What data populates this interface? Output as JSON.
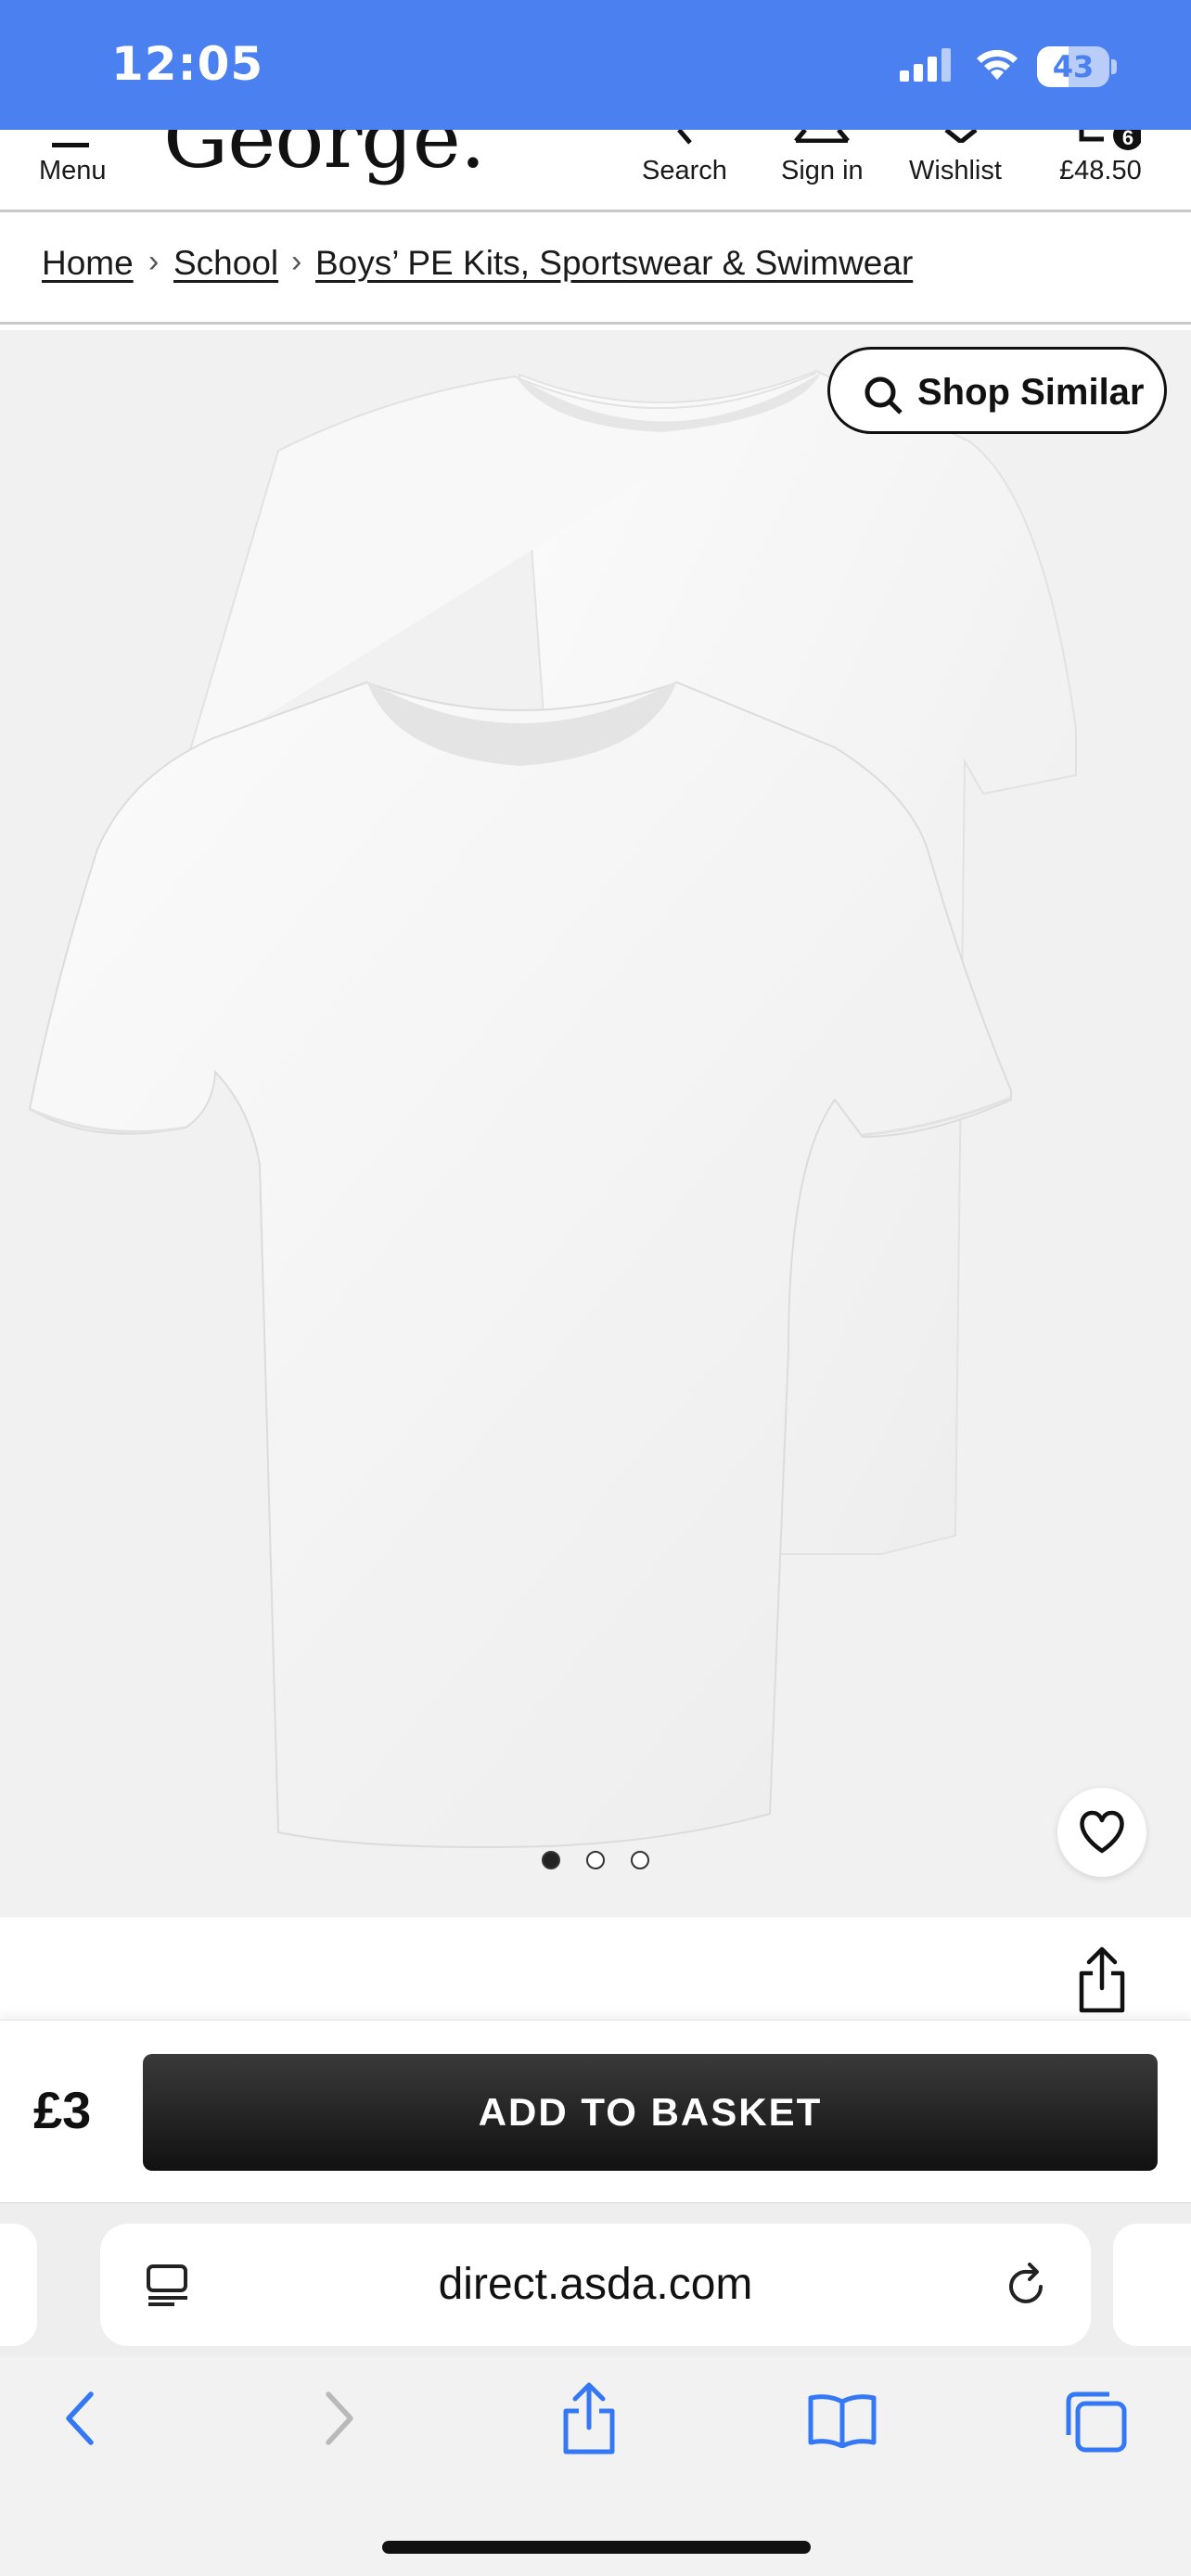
{
  "status_bar": {
    "time": "12:05",
    "battery_level": "43",
    "signal_icon": "cellular-signal-icon",
    "wifi_icon": "wifi-icon"
  },
  "header": {
    "menu_label": "Menu",
    "logo": "George.",
    "search_label": "Search",
    "signin_label": "Sign in",
    "wishlist_label": "Wishlist",
    "basket_total": "£48.50",
    "basket_count": "6"
  },
  "breadcrumb": [
    {
      "label": "Home"
    },
    {
      "label": "School"
    },
    {
      "label": "Boys’ PE Kits, Sportswear & Swimwear"
    }
  ],
  "gallery": {
    "shop_similar_label": "Shop Similar",
    "image_count": 3,
    "active_index": 0
  },
  "purchase": {
    "price": "£3",
    "add_to_basket_label": "ADD TO BASKET"
  },
  "browser": {
    "url": "direct.asda.com"
  },
  "colors": {
    "status_bar": "#4a80ef",
    "ios_blue": "#3478f6",
    "button_dark": "#1a1a1a"
  }
}
